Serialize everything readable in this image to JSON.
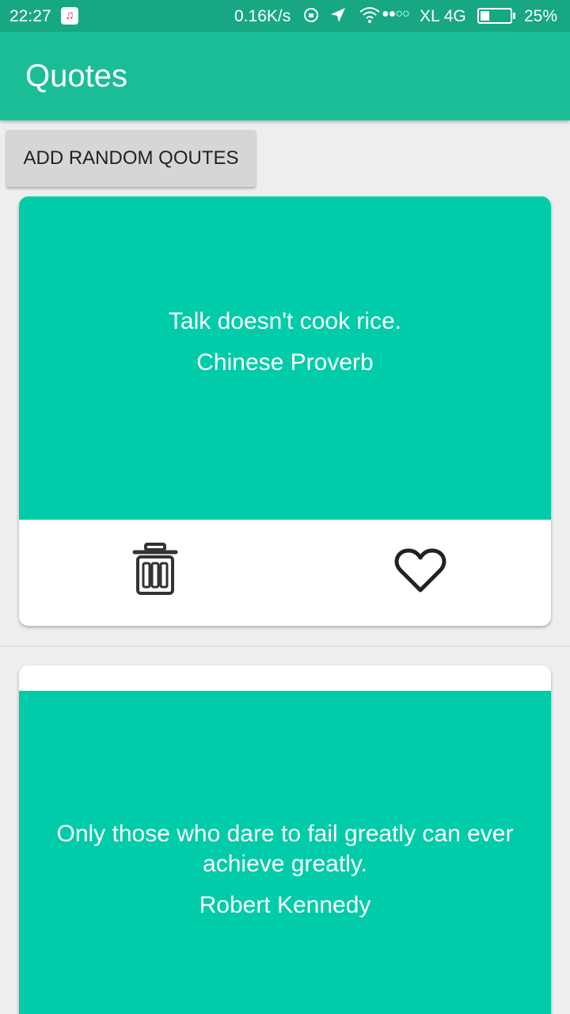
{
  "status_bar": {
    "time": "22:27",
    "network_speed": "0.16K/s",
    "carrier": "XL 4G",
    "battery": "25%",
    "icons": [
      "music-app-icon",
      "rotation-lock-icon",
      "location-icon",
      "wifi-icon",
      "signal-dots-icon",
      "battery-icon"
    ]
  },
  "app_bar": {
    "title": "Quotes"
  },
  "actions": {
    "add_button": "ADD RANDOM QOUTES"
  },
  "quotes": [
    {
      "text": "Talk doesn't cook rice.",
      "author": "Chinese Proverb",
      "actions": [
        "trash-icon",
        "heart-icon"
      ]
    },
    {
      "text": "Only those who dare to fail greatly can ever achieve greatly.",
      "author": "Robert Kennedy"
    }
  ],
  "colors": {
    "status_bar": "#17a883",
    "app_bar": "#1bbd96",
    "quote_card": "#00cca9",
    "background": "#eeeeee"
  }
}
